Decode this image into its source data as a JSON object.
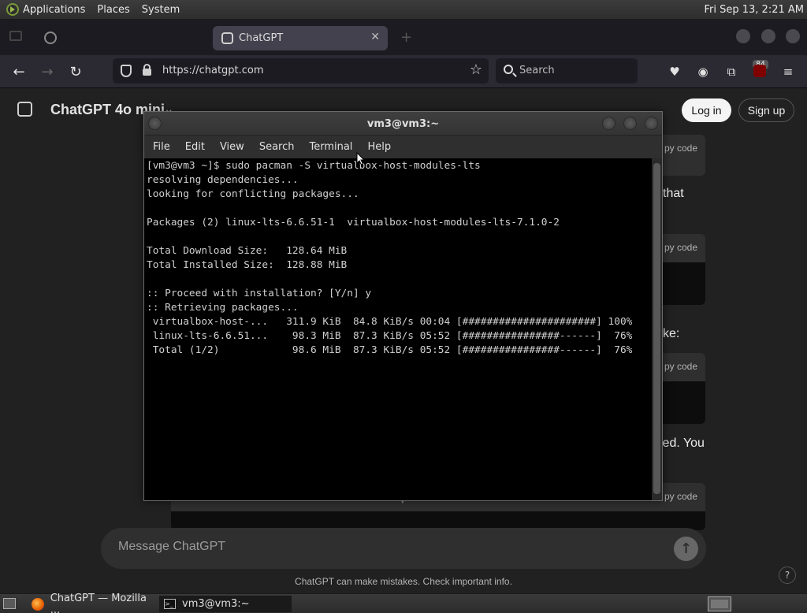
{
  "top_panel": {
    "menus": [
      "Applications",
      "Places",
      "System"
    ],
    "clock": "Fri Sep 13,  2:21 AM"
  },
  "browser": {
    "inactive_tab_label": "",
    "active_tab_label": "ChatGPT",
    "url": "https://chatgpt.com",
    "search_placeholder": "Search",
    "extension_badge": "84"
  },
  "chatgpt": {
    "model_title": "ChatGPT 4o mini",
    "login_label": "Log in",
    "signup_label": "Sign up",
    "copy_code_label": "py code",
    "fragments": [
      "that",
      "ke:",
      "led. You"
    ],
    "composer_placeholder": "Message ChatGPT",
    "disclaimer": "ChatGPT can make mistakes. Check important info.",
    "help_label": "?"
  },
  "terminal": {
    "title": "vm3@vm3:~",
    "menus": [
      "File",
      "Edit",
      "View",
      "Search",
      "Terminal",
      "Help"
    ],
    "lines": [
      "[vm3@vm3 ~]$ sudo pacman -S virtualbox-host-modules-lts",
      "resolving dependencies...",
      "looking for conflicting packages...",
      "",
      "Packages (2) linux-lts-6.6.51-1  virtualbox-host-modules-lts-7.1.0-2",
      "",
      "Total Download Size:   128.64 MiB",
      "Total Installed Size:  128.88 MiB",
      "",
      ":: Proceed with installation? [Y/n] y",
      ":: Retrieving packages...",
      " virtualbox-host-...   311.9 KiB  84.8 KiB/s 00:04 [######################] 100%",
      " linux-lts-6.6.51...    98.3 MiB  87.3 KiB/s 05:52 [################------]  76%",
      " Total (1/2)            98.6 MiB  87.3 KiB/s 05:52 [################------]  76%"
    ]
  },
  "taskbar": {
    "items": [
      "ChatGPT — Mozilla ...",
      "vm3@vm3:~"
    ]
  }
}
